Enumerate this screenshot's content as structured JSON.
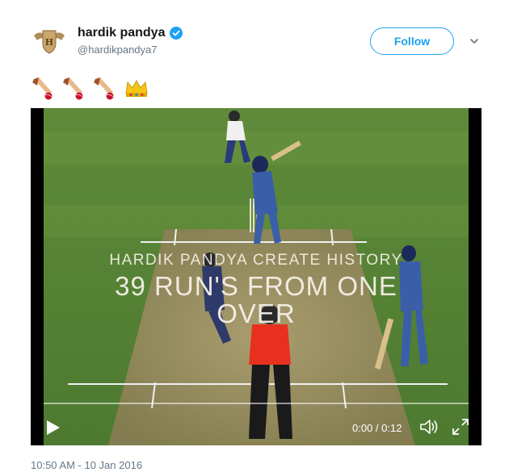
{
  "user": {
    "display_name": "hardik pandya",
    "handle": "@hardikpandya7",
    "verified": true
  },
  "follow_label": "Follow",
  "tweet": {
    "emojis": [
      "cricket-bat-ball-emoji",
      "cricket-bat-ball-emoji",
      "cricket-bat-ball-emoji",
      "crown-emoji"
    ]
  },
  "video": {
    "caption_line1": "HARDIK PANDYA CREATE HISTORY",
    "caption_line2": "39 RUN'S FROM ONE",
    "caption_line3": "OVER",
    "time": "0:00 / 0:12",
    "progress": 0
  },
  "timestamp": "10:50 AM - 10 Jan 2016",
  "colors": {
    "accent": "#1da1f2",
    "secondary_text": "#657786"
  }
}
